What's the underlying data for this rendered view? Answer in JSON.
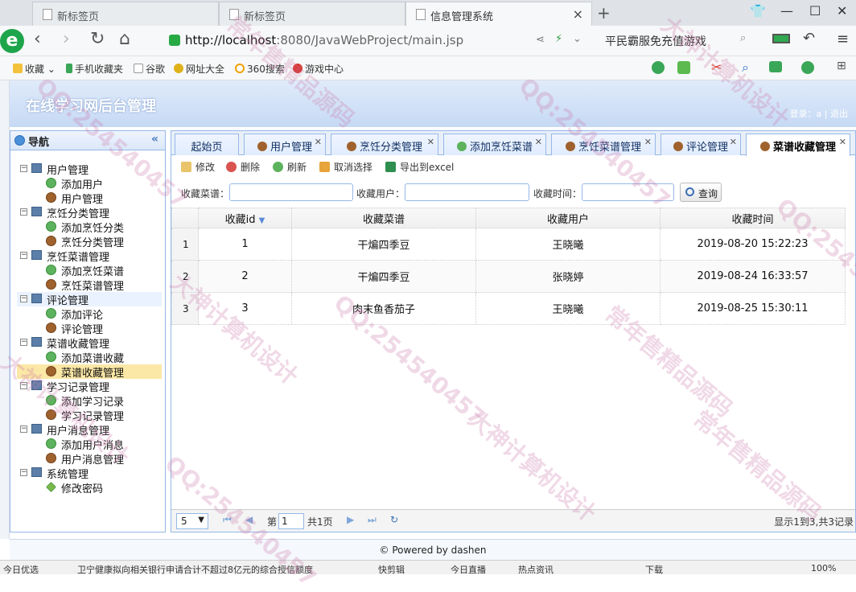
{
  "browser": {
    "tabs": [
      {
        "label": "新标签页",
        "active": false
      },
      {
        "label": "新标签页",
        "active": false
      },
      {
        "label": "信息管理系统",
        "active": true
      }
    ],
    "url_host": "http://localhost",
    "url_path": ":8080/JavaWebProject/main.jsp",
    "promo": "平民霸服免充值游戏",
    "bookmarks": [
      "收藏",
      "手机收藏夹",
      "谷歌",
      "网址大全",
      "360搜索",
      "游戏中心"
    ]
  },
  "app": {
    "title": "在线学习网后台管理",
    "user_info": "登录：a | 退出"
  },
  "nav": {
    "title": "导航",
    "groups": [
      {
        "label": "用户管理",
        "items": [
          {
            "label": "添加用户",
            "icon": "add"
          },
          {
            "label": "用户管理",
            "icon": "user"
          }
        ]
      },
      {
        "label": "烹饪分类管理",
        "items": [
          {
            "label": "添加烹饪分类",
            "icon": "add"
          },
          {
            "label": "烹饪分类管理",
            "icon": "user"
          }
        ]
      },
      {
        "label": "烹饪菜谱管理",
        "items": [
          {
            "label": "添加烹饪菜谱",
            "icon": "add"
          },
          {
            "label": "烹饪菜谱管理",
            "icon": "user"
          }
        ]
      },
      {
        "label": "评论管理",
        "items": [
          {
            "label": "添加评论",
            "icon": "add"
          },
          {
            "label": "评论管理",
            "icon": "user"
          }
        ]
      },
      {
        "label": "菜谱收藏管理",
        "items": [
          {
            "label": "添加菜谱收藏",
            "icon": "add"
          },
          {
            "label": "菜谱收藏管理",
            "icon": "user"
          }
        ]
      },
      {
        "label": "学习记录管理",
        "items": [
          {
            "label": "添加学习记录",
            "icon": "add"
          },
          {
            "label": "学习记录管理",
            "icon": "user"
          }
        ]
      },
      {
        "label": "用户消息管理",
        "items": [
          {
            "label": "添加用户消息",
            "icon": "add"
          },
          {
            "label": "用户消息管理",
            "icon": "user"
          }
        ]
      },
      {
        "label": "系统管理",
        "items": [
          {
            "label": "修改密码",
            "icon": "pen"
          }
        ]
      }
    ],
    "selected": "菜谱收藏管理"
  },
  "page_tabs": [
    {
      "label": "起始页",
      "icon": "none",
      "closable": false
    },
    {
      "label": "用户管理",
      "icon": "user",
      "closable": true
    },
    {
      "label": "烹饪分类管理",
      "icon": "user",
      "closable": true
    },
    {
      "label": "添加烹饪菜谱",
      "icon": "add",
      "closable": true
    },
    {
      "label": "烹饪菜谱管理",
      "icon": "user",
      "closable": true
    },
    {
      "label": "评论管理",
      "icon": "user",
      "closable": true
    },
    {
      "label": "菜谱收藏管理",
      "icon": "user",
      "closable": true,
      "active": true
    }
  ],
  "toolbar": {
    "edit": "修改",
    "delete": "删除",
    "refresh": "刷新",
    "cancel": "取消选择",
    "export": "导出到excel"
  },
  "search": {
    "recipe_label": "收藏菜谱：",
    "user_label": "收藏用户：",
    "time_label": "收藏时间：",
    "query": "查询"
  },
  "grid": {
    "columns": [
      "收藏id",
      "收藏菜谱",
      "收藏用户",
      "收藏时间"
    ],
    "rows": [
      {
        "rn": "1",
        "id": "1",
        "recipe": "干煸四季豆",
        "user": "王晓曦",
        "time": "2019-08-20 15:22:23"
      },
      {
        "rn": "2",
        "id": "2",
        "recipe": "干煸四季豆",
        "user": "张晓婷",
        "time": "2019-08-24 16:33:57"
      },
      {
        "rn": "3",
        "id": "3",
        "recipe": "肉末鱼香茄子",
        "user": "王晓曦",
        "time": "2019-08-25 15:30:11"
      }
    ]
  },
  "pager": {
    "page_size": "5",
    "page_prefix": "第",
    "page_value": "1",
    "page_suffix": "共1页",
    "summary": "显示1到3,共3记录"
  },
  "footer": "© Powered by dashen",
  "statusbar": {
    "left": "今日优选",
    "news": "卫宁健康拟向相关银行申请合计不超过8亿元的综合授信额度",
    "items": [
      "快剪辑",
      "今日直播",
      "热点资讯",
      "下载"
    ],
    "zoom": "100%"
  },
  "watermarks": [
    "QQ:254540457",
    "大神计算机设计",
    "常年售精品源码"
  ]
}
